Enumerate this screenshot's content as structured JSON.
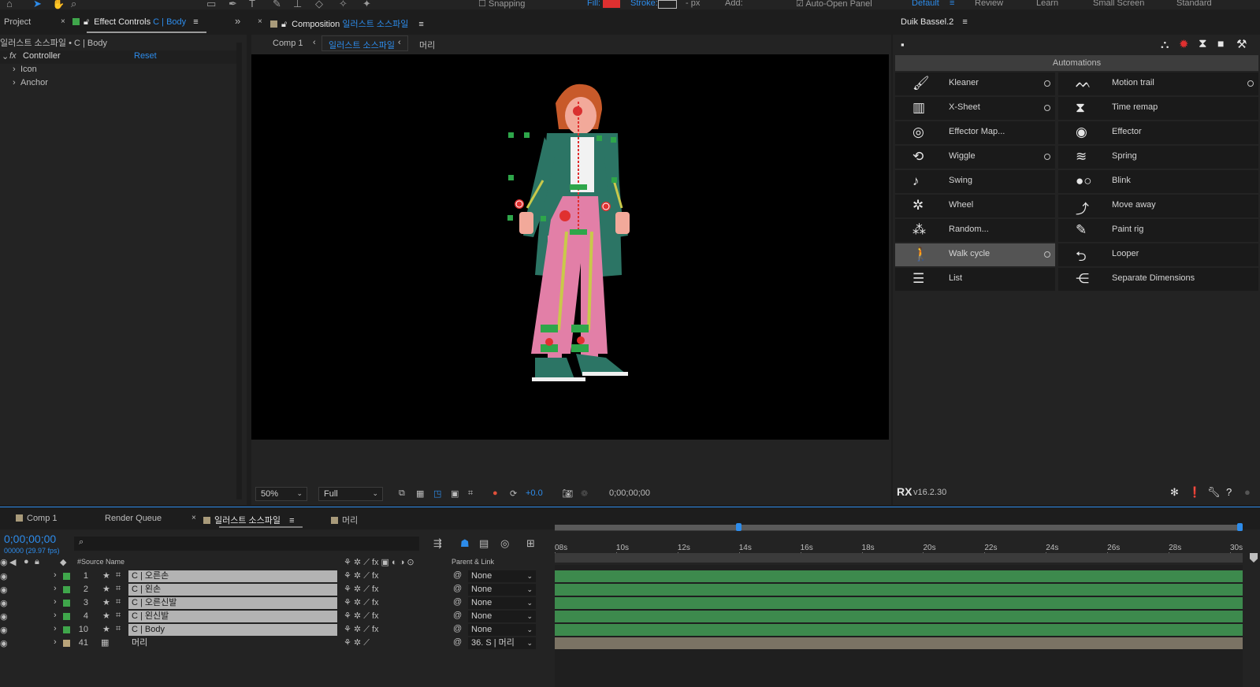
{
  "toolbar": {
    "snapping": "Snapping",
    "fill_label": "Fill:",
    "stroke_label": "Stroke:",
    "stroke_px": "- px",
    "add_label": "Add:",
    "auto_open": "Auto-Open Panel",
    "workspaces": [
      "Default",
      "Review",
      "Learn",
      "Small Screen",
      "Standard"
    ]
  },
  "left_panel": {
    "tab_project": "Project",
    "tab_effect_prefix": "Effect Controls",
    "tab_effect_layer": "C | Body",
    "header": "일러스트 소스파일 • C | Body",
    "fx_label": "fx",
    "controller": "Controller",
    "reset": "Reset",
    "props": [
      "Icon",
      "Anchor"
    ]
  },
  "composition": {
    "tab_prefix": "Composition",
    "tab_name": "일러스트 소스파일",
    "crumbs": [
      "Comp 1",
      "일러스트 소스파일",
      "머리"
    ],
    "zoom": "50%",
    "resolution": "Full",
    "exposure": "+0.0",
    "timecode": "0;00;00;00"
  },
  "duik": {
    "title": "Duik Bassel.2",
    "section": "Automations",
    "version": "v16.2.30",
    "left_items": [
      {
        "label": "Kleaner",
        "icon": "broom-icon",
        "glyph": "🖌",
        "dot": true,
        "selected": false
      },
      {
        "label": "X-Sheet",
        "icon": "xsheet-icon",
        "glyph": "▥",
        "dot": true,
        "selected": false
      },
      {
        "label": "Effector Map...",
        "icon": "effector-map-icon",
        "glyph": "◎",
        "dot": false,
        "selected": false
      },
      {
        "label": "Wiggle",
        "icon": "wiggle-icon",
        "glyph": "⟲",
        "dot": true,
        "selected": false
      },
      {
        "label": "Swing",
        "icon": "swing-icon",
        "glyph": "♪",
        "dot": false,
        "selected": false
      },
      {
        "label": "Wheel",
        "icon": "wheel-icon",
        "glyph": "✲",
        "dot": false,
        "selected": false
      },
      {
        "label": "Random...",
        "icon": "random-icon",
        "glyph": "⁂",
        "dot": false,
        "selected": false
      },
      {
        "label": "Walk cycle",
        "icon": "walk-cycle-icon",
        "glyph": "🚶",
        "dot": true,
        "selected": true
      },
      {
        "label": "List",
        "icon": "list-icon",
        "glyph": "☰",
        "dot": false,
        "selected": false
      }
    ],
    "right_items": [
      {
        "label": "Motion trail",
        "icon": "motion-trail-icon",
        "glyph": "ᨓ",
        "dot": true
      },
      {
        "label": "Time remap",
        "icon": "time-remap-icon",
        "glyph": "⧗",
        "dot": false
      },
      {
        "label": "Effector",
        "icon": "effector-icon",
        "glyph": "◉",
        "dot": false
      },
      {
        "label": "Spring",
        "icon": "spring-icon",
        "glyph": "≋",
        "dot": false
      },
      {
        "label": "Blink",
        "icon": "blink-icon",
        "glyph": "●○",
        "dot": false
      },
      {
        "label": "Move away",
        "icon": "move-away-icon",
        "glyph": "⤴",
        "dot": false
      },
      {
        "label": "Paint rig",
        "icon": "paint-rig-icon",
        "glyph": "✎",
        "dot": false
      },
      {
        "label": "Looper",
        "icon": "looper-icon",
        "glyph": "⮌",
        "dot": false
      },
      {
        "label": "Separate Dimensions",
        "icon": "separate-dimensions-icon",
        "glyph": "⋲",
        "dot": false
      }
    ]
  },
  "timeline": {
    "tabs": [
      "Comp 1",
      "Render Queue",
      "일러스트 소스파일",
      "머리"
    ],
    "timecode": "0;00;00;00",
    "fps": "00000 (29.97 fps)",
    "col_hash": "#",
    "col_source": "Source Name",
    "col_parent": "Parent & Link",
    "ruler": [
      "08s",
      "10s",
      "12s",
      "14s",
      "16s",
      "18s",
      "20s",
      "22s",
      "24s",
      "26s",
      "28s",
      "30s"
    ],
    "layers": [
      {
        "num": "1",
        "name": "C | 오른손",
        "parent": "None",
        "kind": "shape"
      },
      {
        "num": "2",
        "name": "C | 왼손",
        "parent": "None",
        "kind": "shape"
      },
      {
        "num": "3",
        "name": "C | 오른신발",
        "parent": "None",
        "kind": "shape"
      },
      {
        "num": "4",
        "name": "C | 왼신발",
        "parent": "None",
        "kind": "shape"
      },
      {
        "num": "10",
        "name": "C | Body",
        "parent": "None",
        "kind": "shape"
      },
      {
        "num": "41",
        "name": "머리",
        "parent": "36. S | 머리",
        "kind": "precomp"
      }
    ]
  },
  "colors": {
    "accent_blue": "#2d8ceb",
    "layer_green": "#3d8a4d",
    "label_green": "#3fa64b",
    "fill_red": "#e03030"
  }
}
